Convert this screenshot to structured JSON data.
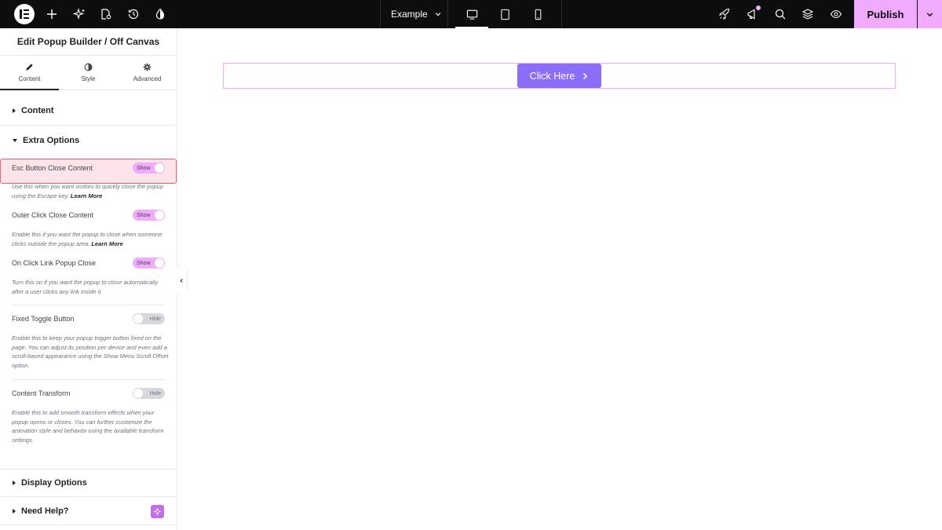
{
  "topbar": {
    "page_title": "Example",
    "publish_label": "Publish",
    "icons": [
      "elementor-logo-icon",
      "add-element-icon",
      "ai-sparkle-icon",
      "page-settings-icon",
      "history-icon",
      "site-style-icon",
      "desktop-icon",
      "tablet-icon",
      "mobile-icon",
      "rocket-icon",
      "notifications-icon",
      "search-icon",
      "structure-layers-icon",
      "preview-eye-icon",
      "chevron-down-icon"
    ]
  },
  "panel": {
    "title": "Edit Popup Builder / Off Canvas",
    "tabs": [
      {
        "label": "Content",
        "icon": "pencil-icon",
        "active": true
      },
      {
        "label": "Style",
        "icon": "contrast-icon",
        "active": false
      },
      {
        "label": "Advanced",
        "icon": "gear-icon",
        "active": false
      }
    ],
    "section_content": "Content",
    "section_extra": "Extra Options",
    "controls": [
      {
        "label": "Esc Button Close Content",
        "state": "Show",
        "on": true,
        "desc": "Use this when you want visitors to quickly close the popup using the Escape key.",
        "link": "Learn More"
      },
      {
        "label": "Outer Click Close Content",
        "state": "Show",
        "on": true,
        "desc": "Enable this if you want the popup to close when someone clicks outside the popup area.",
        "link": "Learn More"
      },
      {
        "label": "On Click Link Popup Close",
        "state": "Show",
        "on": true,
        "desc": "Turn this on if you want the popup to close automatically after a user clicks any link inside it.",
        "link": ""
      },
      {
        "label": "Fixed Toggle Button",
        "state": "Hide",
        "on": false,
        "desc": "Enable this to keep your popup trigger button fixed on the page. You can adjust its position per device and even add a scroll-based appearance using the Show Menu Scroll Offset option.",
        "link": ""
      },
      {
        "label": "Content Transform",
        "state": "Hide",
        "on": false,
        "desc": "Enable this to add smooth transform effects when your popup opens or closes. You can further customize the animation style and behavior using the available transform settings.",
        "link": ""
      }
    ],
    "section_display": "Display Options",
    "section_help": "Need Help?"
  },
  "canvas": {
    "button_label": "Click Here"
  },
  "colors": {
    "topbar": "#0c0d0e",
    "accent_pink": "#f0abfc",
    "button_purple": "#8a6df9",
    "highlight_red": "#e8626e"
  }
}
